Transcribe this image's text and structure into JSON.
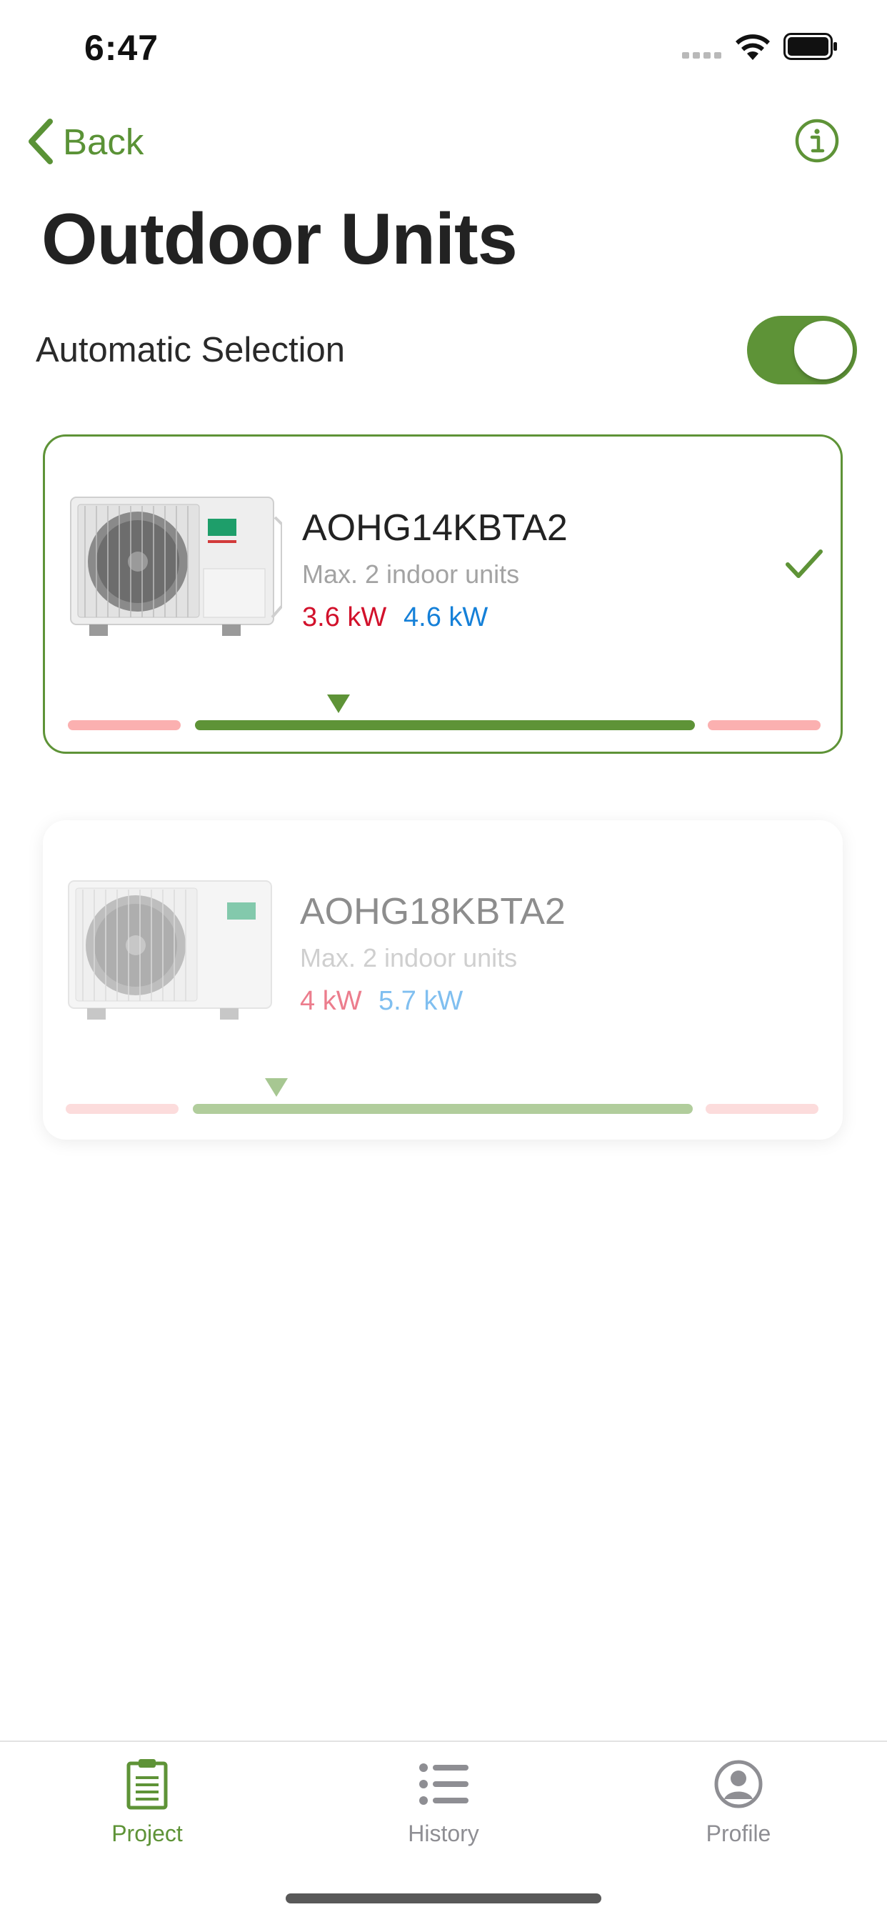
{
  "status_bar": {
    "time": "6:47"
  },
  "nav": {
    "back_label": "Back",
    "info_icon": "info-circle-icon"
  },
  "page_title": "Outdoor Units",
  "automatic_selection": {
    "label": "Automatic Selection",
    "enabled": true
  },
  "units": [
    {
      "model": "AOHG14KBTA2",
      "subtitle": "Max. 2 indoor units",
      "cooling": "3.6 kW",
      "heating": "4.6 kW",
      "selected": true
    },
    {
      "model": "AOHG18KBTA2",
      "subtitle": "Max. 2 indoor units",
      "cooling": "4 kW",
      "heating": "5.7 kW",
      "selected": false
    }
  ],
  "tabs": [
    {
      "label": "Project",
      "icon": "clipboard-icon",
      "active": true
    },
    {
      "label": "History",
      "icon": "list-icon",
      "active": false
    },
    {
      "label": "Profile",
      "icon": "user-circle-icon",
      "active": false
    }
  ],
  "colors": {
    "accent": "#5e9337",
    "cooling": "#d2112b",
    "heating": "#1580d8",
    "range_out": "#fbb0b0"
  }
}
